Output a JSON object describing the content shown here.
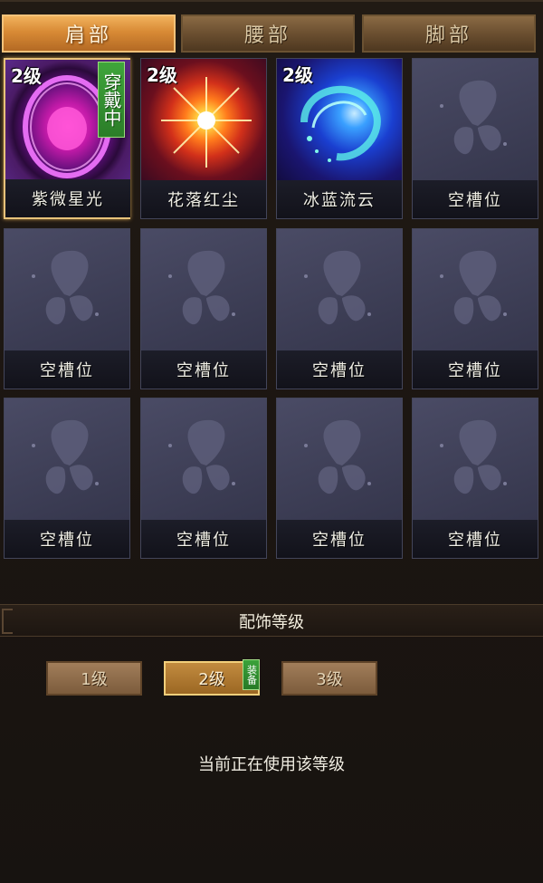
{
  "tabs": [
    {
      "label": "肩部",
      "active": true
    },
    {
      "label": "腰部",
      "active": false
    },
    {
      "label": "脚部",
      "active": false
    }
  ],
  "slots": [
    {
      "name": "紫微星光",
      "level": "2级",
      "wearing": "穿戴中",
      "icon": "purple-orb-icon",
      "filled": true
    },
    {
      "name": "花落红尘",
      "level": "2级",
      "icon": "red-starburst-icon",
      "filled": true
    },
    {
      "name": "冰蓝流云",
      "level": "2级",
      "icon": "blue-swirl-icon",
      "filled": true
    },
    {
      "name": "空槽位",
      "icon": "butterfly-placeholder-icon",
      "filled": false
    },
    {
      "name": "空槽位",
      "icon": "butterfly-placeholder-icon",
      "filled": false
    },
    {
      "name": "空槽位",
      "icon": "butterfly-placeholder-icon",
      "filled": false
    },
    {
      "name": "空槽位",
      "icon": "butterfly-placeholder-icon",
      "filled": false
    },
    {
      "name": "空槽位",
      "icon": "butterfly-placeholder-icon",
      "filled": false
    },
    {
      "name": "空槽位",
      "icon": "butterfly-placeholder-icon",
      "filled": false
    },
    {
      "name": "空槽位",
      "icon": "butterfly-placeholder-icon",
      "filled": false
    },
    {
      "name": "空槽位",
      "icon": "butterfly-placeholder-icon",
      "filled": false
    },
    {
      "name": "空槽位",
      "icon": "butterfly-placeholder-icon",
      "filled": false
    }
  ],
  "section": {
    "title": "配饰等级"
  },
  "levels": [
    {
      "label": "1级",
      "active": false
    },
    {
      "label": "2级",
      "active": true,
      "badge": "装备"
    },
    {
      "label": "3级",
      "active": false
    }
  ],
  "status": "当前正在使用该等级",
  "colors": {
    "tab_active": "#d88a35",
    "tab_inactive": "#6b4f30",
    "wear_badge": "#3fa53b",
    "selected_border": "#e7c27a",
    "slot_bg": "#35364c"
  }
}
